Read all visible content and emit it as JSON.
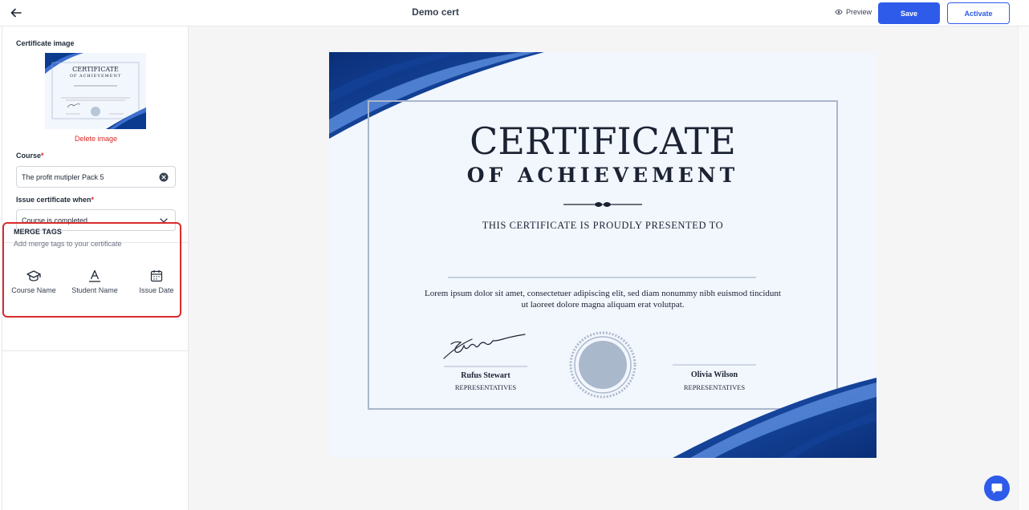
{
  "header": {
    "title": "Demo cert",
    "preview_label": "Preview",
    "save_label": "Save",
    "activate_label": "Activate"
  },
  "sidebar": {
    "certificate_image_label": "Certificate image",
    "delete_image_label": "Delete image",
    "course_label": "Course",
    "course_value": "The profit mutipler Pack 5",
    "issue_label": "Issue certificate when",
    "issue_value": "Course is completed",
    "required_mark": "*"
  },
  "merge_tags": {
    "title": "MERGE TAGS",
    "subtitle": "Add merge tags to your certificate",
    "items": [
      {
        "label": "Course Name",
        "icon": "graduation-cap-icon"
      },
      {
        "label": "Student Name",
        "icon": "text-format-icon"
      },
      {
        "label": "Issue Date",
        "icon": "calendar-icon"
      }
    ]
  },
  "certificate": {
    "heading": "CERTIFICATE",
    "subheading": "OF ACHIEVEMENT",
    "presented": "THIS CERTIFICATE IS PROUDLY PRESENTED TO",
    "body_line1": "Lorem ipsum dolor sit amet, consectetuer adipiscing elit, sed diam nonummy nibh euismod tincidunt",
    "body_line2": "ut laoreet dolore magna aliquam erat volutpat.",
    "signer1_name": "Rufus Stewart",
    "signer1_role": "REPRESENTATIVES",
    "signer2_name": "Olivia Wilson",
    "signer2_role": "REPRESENTATIVES",
    "signature_text": "Signature"
  },
  "thumbnail": {
    "heading": "CERTIFICATE",
    "subheading": "OF ACHIEVEMENT"
  },
  "colors": {
    "accent": "#2f5bea",
    "danger": "#dc2626",
    "cert_navy": "#0b3b8f",
    "cert_text": "#1b2333"
  }
}
